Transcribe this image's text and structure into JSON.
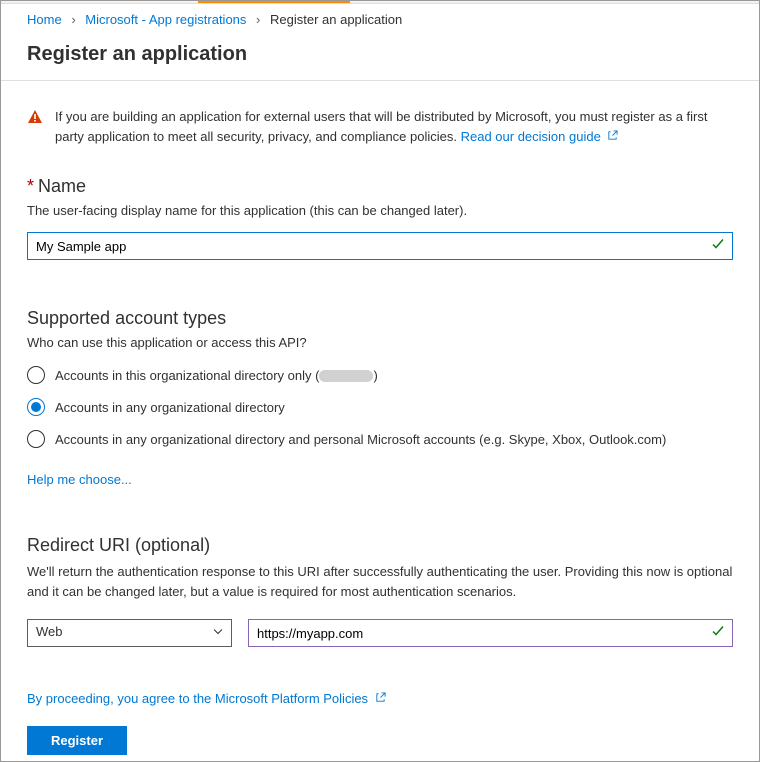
{
  "breadcrumb": {
    "home": "Home",
    "appreg": "Microsoft - App registrations",
    "current": "Register an application"
  },
  "title": "Register an application",
  "warning": {
    "text": "If you are building an application for external users that will be distributed by Microsoft, you must register as a first party application to meet all security, privacy, and compliance policies. ",
    "link": "Read our decision guide"
  },
  "name": {
    "label": "Name",
    "hint": "The user-facing display name for this application (this can be changed later).",
    "value": "My Sample app"
  },
  "accountTypes": {
    "title": "Supported account types",
    "hint": "Who can use this application or access this API?",
    "options": {
      "opt1_prefix": "Accounts in this organizational directory only (",
      "opt1_suffix": ")",
      "opt2": "Accounts in any organizational directory",
      "opt3": "Accounts in any organizational directory and personal Microsoft accounts (e.g. Skype, Xbox, Outlook.com)"
    },
    "helpLink": "Help me choose..."
  },
  "redirect": {
    "title": "Redirect URI (optional)",
    "hint": "We'll return the authentication response to this URI after successfully authenticating the user. Providing this now is optional and it can be changed later, but a value is required for most authentication scenarios.",
    "platform": "Web",
    "uri": "https://myapp.com"
  },
  "agree": {
    "prefix": "By proceeding, you agree to the ",
    "link": "Microsoft Platform Policies"
  },
  "registerBtn": "Register"
}
